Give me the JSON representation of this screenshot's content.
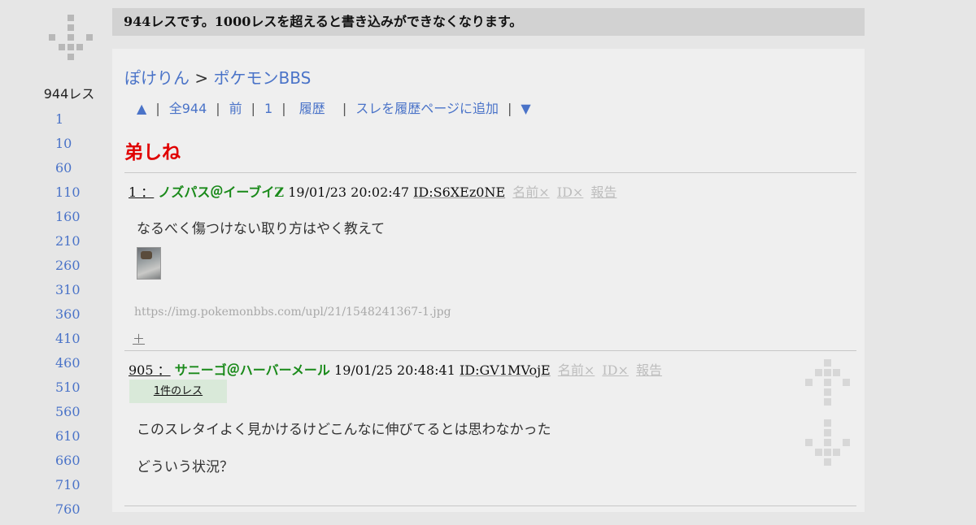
{
  "sidebar": {
    "res_count": "944レス",
    "jump_links": [
      "1",
      "10",
      "60",
      "110",
      "160",
      "210",
      "260",
      "310",
      "360",
      "410",
      "460",
      "510",
      "560",
      "610",
      "660",
      "710",
      "760"
    ]
  },
  "notice": "944レスです。1000レスを超えると書き込みができなくなります。",
  "breadcrumb": {
    "site": "ぽけりん",
    "separator": ">",
    "board": "ポケモンBBS"
  },
  "nav": {
    "top": "▲",
    "all": "全944",
    "prev": "前",
    "first": "1",
    "history": "履歴",
    "add_history": "スレを履歴ページに追加",
    "bottom": "▼",
    "separator": "|"
  },
  "thread_title": "弟しね",
  "posts": [
    {
      "number": "1 ：",
      "name": "ノズパス＠イーブイZ",
      "datetime": "19/01/23 20:02:47",
      "id": "ID:S6XEz0NE",
      "name_block": "名前×",
      "id_block": "ID×",
      "report": "報告",
      "body": [
        "なるべく傷つけない取り方はやく教えて"
      ],
      "image_url": "https://img.pokemonbbs.com/upl/21/1548241367-1.jpg",
      "expand": "＋"
    },
    {
      "number": "905 ：",
      "name": "サニーゴ＠ハーバーメール",
      "datetime": "19/01/25 20:48:41",
      "id": "ID:GV1MVojE",
      "name_block": "名前×",
      "id_block": "ID×",
      "report": "報告",
      "replies": "1件のレス",
      "body": [
        "このスレタイよく見かけるけどこんなに伸びてるとは思わなかった",
        "どういう状況？"
      ]
    }
  ]
}
